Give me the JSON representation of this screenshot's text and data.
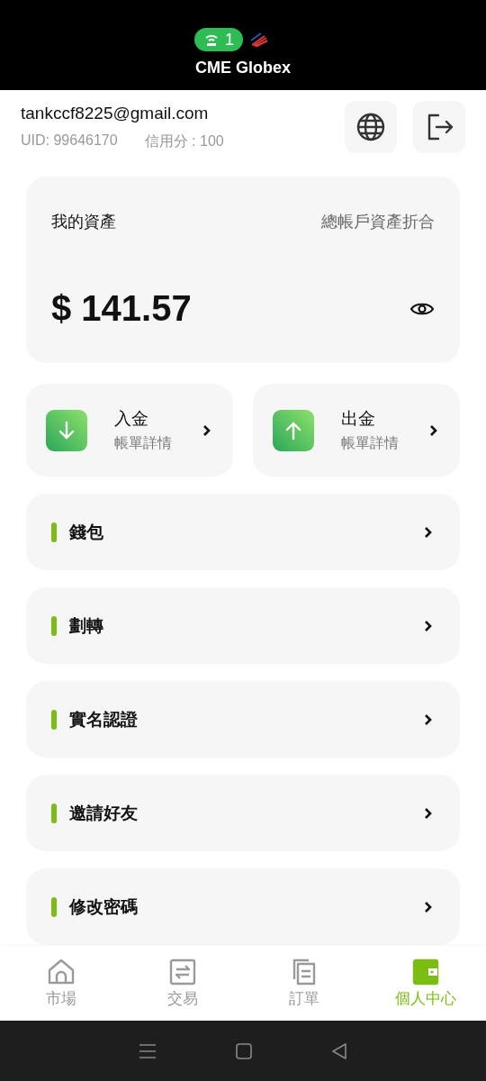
{
  "status_bar": {
    "hotspot_count": "1",
    "title": "CME Globex"
  },
  "account": {
    "email": "tankccf8225@gmail.com",
    "uid": "UID: 99646170",
    "credit": "信用分 : 100"
  },
  "assets": {
    "title": "我的資產",
    "subtitle": "總帳戶資產折合",
    "amount": "$ 141.57"
  },
  "actions": [
    {
      "kind": "deposit",
      "label": "入金",
      "sublabel": "帳單詳情"
    },
    {
      "kind": "withdraw",
      "label": "出金",
      "sublabel": "帳單詳情"
    }
  ],
  "menu": [
    {
      "label": "錢包"
    },
    {
      "label": "劃轉"
    },
    {
      "label": "實名認證"
    },
    {
      "label": "邀請好友"
    },
    {
      "label": "修改密碼"
    }
  ],
  "tabs": [
    {
      "kind": "market",
      "label": "市場",
      "selected": false
    },
    {
      "kind": "trade",
      "label": "交易",
      "selected": false
    },
    {
      "kind": "orders",
      "label": "訂單",
      "selected": false
    },
    {
      "kind": "profile",
      "label": "個人中心",
      "selected": true
    }
  ]
}
